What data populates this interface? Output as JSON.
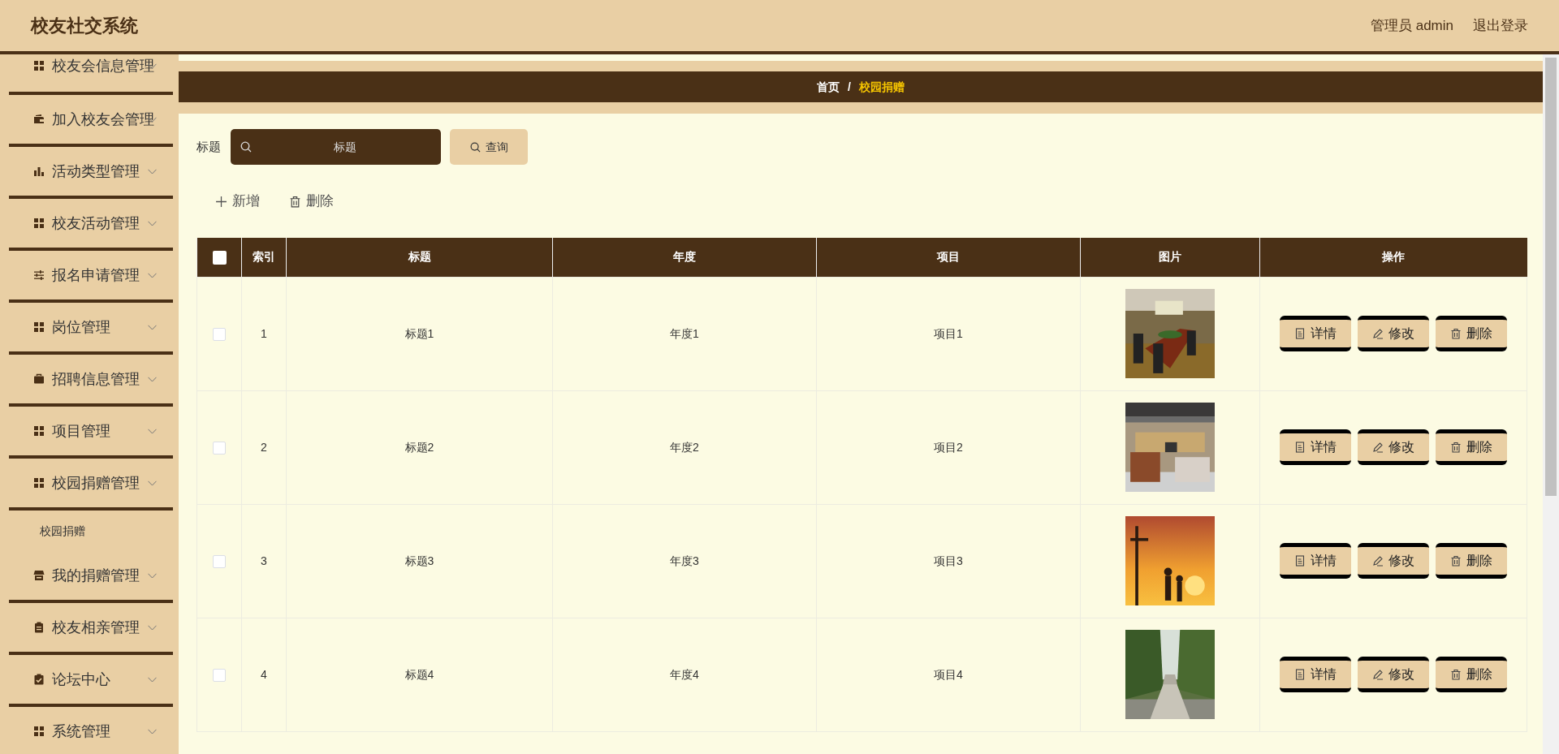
{
  "header": {
    "title": "校友社交系统",
    "user": "管理员 admin",
    "logout": "退出登录"
  },
  "sidebar": {
    "items": [
      {
        "label": "校友会信息管理",
        "kind": "grid"
      },
      {
        "label": "加入校友会管理",
        "kind": "wallet"
      },
      {
        "label": "活动类型管理",
        "kind": "chart"
      },
      {
        "label": "校友活动管理",
        "kind": "grid"
      },
      {
        "label": "报名申请管理",
        "kind": "sliders"
      },
      {
        "label": "岗位管理",
        "kind": "grid"
      },
      {
        "label": "招聘信息管理",
        "kind": "briefcase"
      },
      {
        "label": "项目管理",
        "kind": "grid"
      },
      {
        "label": "校园捐赠管理",
        "kind": "grid",
        "children": [
          {
            "label": "校园捐赠"
          }
        ]
      },
      {
        "label": "我的捐赠管理",
        "kind": "store"
      },
      {
        "label": "校友相亲管理",
        "kind": "clipboard"
      },
      {
        "label": "论坛中心",
        "kind": "clipboard-check"
      },
      {
        "label": "系统管理",
        "kind": "grid"
      }
    ]
  },
  "breadcrumb": {
    "home": "首页",
    "separator": "/",
    "current": "校园捐赠"
  },
  "search": {
    "label": "标题",
    "placeholder": "标题",
    "button": "查询"
  },
  "actions": [
    {
      "label": "新增",
      "kind": "add"
    },
    {
      "label": "删除",
      "kind": "delete"
    }
  ],
  "table": {
    "select_all": {
      "checked": false
    },
    "columns": [
      "索引",
      "标题",
      "年度",
      "项目",
      "图片",
      "操作"
    ],
    "rows": [
      {
        "checked": false,
        "index": "1",
        "title": "标题1",
        "year": "年度1",
        "project": "项目1",
        "image": {
          "kind": "picture"
        },
        "buttons": [
          {
            "label": "详情",
            "kind": "detail"
          },
          {
            "label": "修改",
            "kind": "edit"
          },
          {
            "label": "删除",
            "kind": "delete"
          }
        ]
      },
      {
        "checked": false,
        "index": "2",
        "title": "标题2",
        "year": "年度2",
        "project": "项目2",
        "image": {
          "kind": "picture"
        },
        "buttons": [
          {
            "label": "详情",
            "kind": "detail"
          },
          {
            "label": "修改",
            "kind": "edit"
          },
          {
            "label": "删除",
            "kind": "delete"
          }
        ]
      },
      {
        "checked": false,
        "index": "3",
        "title": "标题3",
        "year": "年度3",
        "project": "项目3",
        "image": {
          "kind": "picture"
        },
        "buttons": [
          {
            "label": "详情",
            "kind": "detail"
          },
          {
            "label": "修改",
            "kind": "edit"
          },
          {
            "label": "删除",
            "kind": "delete"
          }
        ]
      },
      {
        "checked": false,
        "index": "4",
        "title": "标题4",
        "year": "年度4",
        "project": "项目4",
        "image": {
          "kind": "picture"
        },
        "buttons": [
          {
            "label": "详情",
            "kind": "detail"
          },
          {
            "label": "修改",
            "kind": "edit"
          },
          {
            "label": "删除",
            "kind": "delete"
          }
        ]
      }
    ]
  }
}
